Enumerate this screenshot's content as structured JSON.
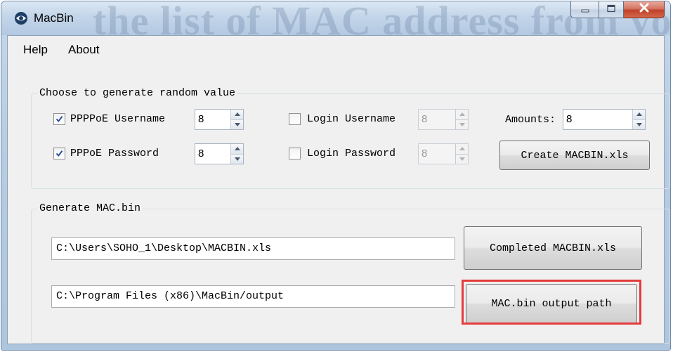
{
  "window": {
    "title": "MacBin",
    "watermark_text": "the list of MAC address from your"
  },
  "menu": {
    "items": [
      {
        "label": "Help"
      },
      {
        "label": "About"
      }
    ]
  },
  "random_group": {
    "legend": "Choose to generate random value",
    "pppoe_username": {
      "label": "PPPPoE Username",
      "checked": true,
      "value": "8"
    },
    "pppoe_password": {
      "label": "PPPoE Password",
      "checked": true,
      "value": "8"
    },
    "login_username": {
      "label": "Login Username",
      "checked": false,
      "value": "8"
    },
    "login_password": {
      "label": "Login Password",
      "checked": false,
      "value": "8"
    },
    "amounts": {
      "label": "Amounts:",
      "value": "8"
    },
    "create_button": "Create MACBIN.xls"
  },
  "macbin_group": {
    "legend": "Generate MAC.bin",
    "xls_path": "C:\\Users\\SOHO_1\\Desktop\\MACBIN.xls",
    "output_path": "C:\\Program Files (x86)\\MacBin/output",
    "completed_button": "Completed MACBIN.xls",
    "output_button": "MAC.bin output path"
  },
  "colors": {
    "highlight": "#e53b3b",
    "checkmark": "#2b4f9e"
  }
}
